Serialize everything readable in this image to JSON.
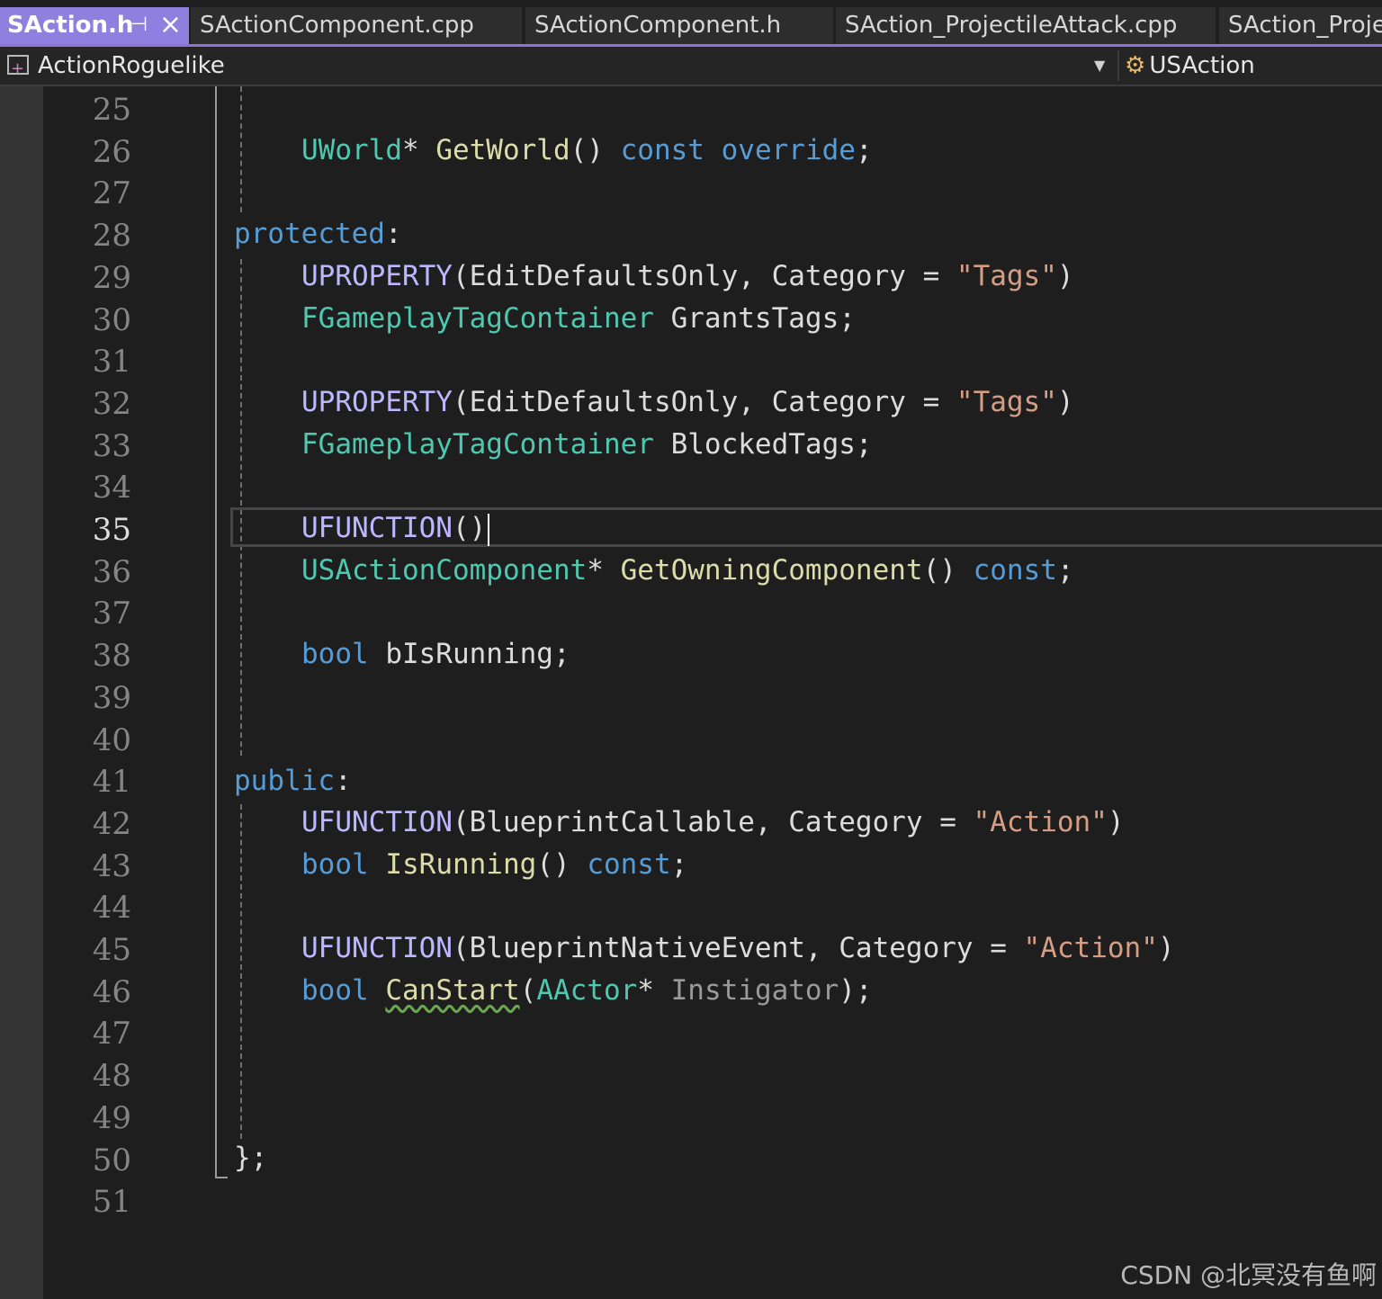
{
  "tabs": [
    {
      "label": "SAction.h",
      "active": true,
      "pin_icon": "pin-icon",
      "close_icon": "close-icon"
    },
    {
      "label": "SActionComponent.cpp",
      "active": false
    },
    {
      "label": "SActionComponent.h",
      "active": false
    },
    {
      "label": "SAction_ProjectileAttack.cpp",
      "active": false
    },
    {
      "label": "SAction_Projec",
      "active": false
    }
  ],
  "navbar": {
    "project": "ActionRoguelike",
    "project_icon": "project-icon",
    "dropdown_icon": "chevron-down-icon",
    "class_name": "USAction",
    "class_icon": "class-icon"
  },
  "editor": {
    "current_line": 35,
    "line_numbers": [
      "25",
      "26",
      "27",
      "28",
      "29",
      "30",
      "31",
      "32",
      "33",
      "34",
      "35",
      "36",
      "37",
      "38",
      "39",
      "40",
      "41",
      "42",
      "43",
      "44",
      "45",
      "46",
      "47",
      "48",
      "49",
      "50",
      "51"
    ],
    "lines": {
      "l26": {
        "t1": "UWorld",
        "t2": "* ",
        "t3": "GetWorld",
        "t4": "() ",
        "t5": "const",
        "t6": " ",
        "t7": "override",
        "t8": ";"
      },
      "l28": {
        "t1": "protected",
        "t2": ":"
      },
      "l29": {
        "t1": "UPROPERTY",
        "t2": "(EditDefaultsOnly, Category = ",
        "t3": "\"Tags\"",
        "t4": ")"
      },
      "l30": {
        "t1": "FGameplayTagContainer",
        "t2": " GrantsTags;"
      },
      "l32": {
        "t1": "UPROPERTY",
        "t2": "(EditDefaultsOnly, Category = ",
        "t3": "\"Tags\"",
        "t4": ")"
      },
      "l33": {
        "t1": "FGameplayTagContainer",
        "t2": " BlockedTags;"
      },
      "l35": {
        "t1": "UFUNCTION",
        "t2": "()"
      },
      "l36": {
        "t1": "USActionComponent",
        "t2": "* ",
        "t3": "GetOwningComponent",
        "t4": "() ",
        "t5": "const",
        "t6": ";"
      },
      "l38": {
        "t1": "bool",
        "t2": " bIsRunning;"
      },
      "l41": {
        "t1": "public",
        "t2": ":"
      },
      "l42": {
        "t1": "UFUNCTION",
        "t2": "(BlueprintCallable, Category = ",
        "t3": "\"Action\"",
        "t4": ")"
      },
      "l43": {
        "t1": "bool",
        "t2": " ",
        "t3": "IsRunning",
        "t4": "() ",
        "t5": "const",
        "t6": ";"
      },
      "l45": {
        "t1": "UFUNCTION",
        "t2": "(BlueprintNativeEvent, Category = ",
        "t3": "\"Action\"",
        "t4": ")"
      },
      "l46": {
        "t1": "bool",
        "t2": " ",
        "t3": "CanStart",
        "t4": "(",
        "t5": "AActor",
        "t6": "* ",
        "t7": "Instigator",
        "t8": ");"
      },
      "l50": {
        "t1": "};"
      }
    }
  },
  "watermark": "CSDN @北冥没有鱼啊",
  "colors": {
    "background": "#1e1e1e",
    "active_tab": "#8f80df",
    "type": "#4ec9b0",
    "keyword": "#569cd6",
    "function": "#dcdcaa",
    "macro": "#beb7ff",
    "string": "#d69d85",
    "line_number": "#858585"
  }
}
